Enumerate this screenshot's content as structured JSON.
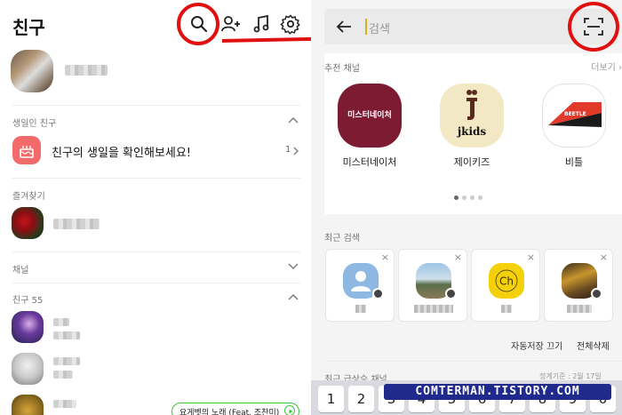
{
  "left": {
    "title": "친구",
    "sections": {
      "birthday": {
        "label": "생일인 친구",
        "cta": "친구의 생일을 확인해보세요!",
        "count": "1"
      },
      "favorites": {
        "label": "즐겨찾기"
      },
      "channel": {
        "label": "채널"
      },
      "friends": {
        "label": "친구 55"
      }
    },
    "music_pill": "요게벳의 노래 (Feat. 조찬미)..."
  },
  "right": {
    "search_placeholder": "검색",
    "recommended": {
      "label": "추천 채널",
      "more": "더보기"
    },
    "channels": [
      {
        "name": "미스터네이처",
        "logo_text": "미스터네이처"
      },
      {
        "name": "제이키즈",
        "logo_text": "jkids"
      },
      {
        "name": "비틀",
        "logo_text": "BEETLE"
      }
    ],
    "recent": {
      "label": "최근 검색",
      "close": "×"
    },
    "actions": {
      "autosave_off": "자동저장 끄기",
      "delete_all": "전체삭제"
    },
    "bottom_label": "최근 급상승 채널",
    "bottom_right": "정계기준 : 2월 17일"
  },
  "keyboard": {
    "keys": [
      "1",
      "2",
      "3",
      "4",
      "5",
      "6",
      "7",
      "8",
      "9",
      "0"
    ]
  },
  "watermark": "COMTERMAN.TISTORY.COM",
  "colors": {
    "annotation": "#e11010",
    "bday_icon_bg": "#f26a6a",
    "maroon": "#7d1b33",
    "watermark_bg": "#1f2a8c"
  }
}
